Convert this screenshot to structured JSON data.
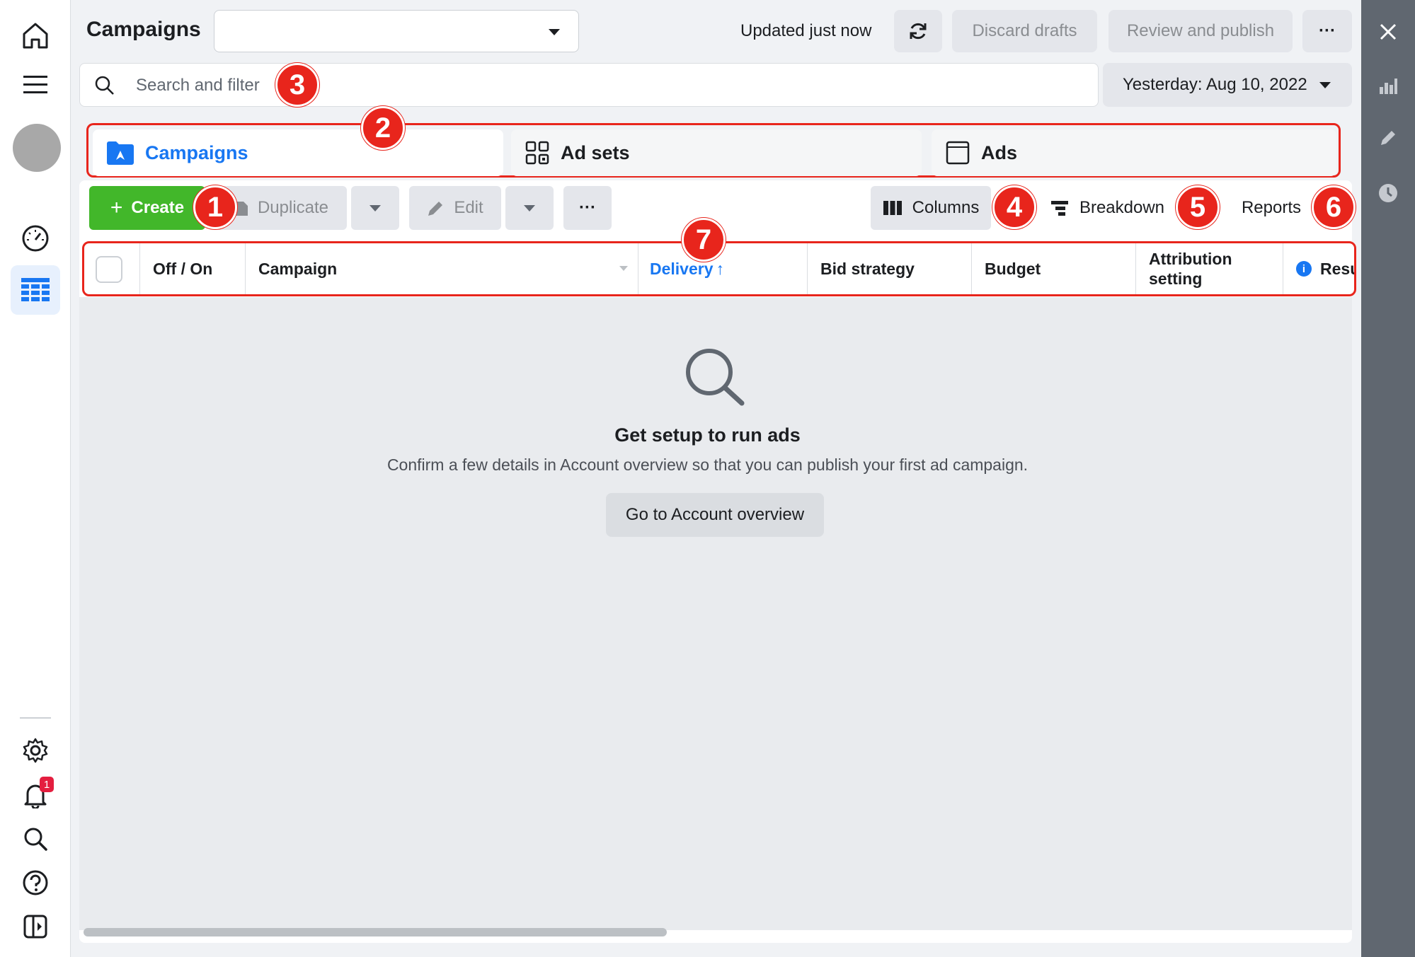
{
  "header": {
    "title": "Campaigns",
    "account_select_value": "",
    "updated_text": "Updated just now",
    "discard_label": "Discard drafts",
    "review_label": "Review and publish",
    "more_label": "···"
  },
  "search": {
    "placeholder": "Search and filter",
    "date_label": "Yesterday: Aug 10, 2022"
  },
  "tabs": [
    {
      "label": "Campaigns",
      "active": true
    },
    {
      "label": "Ad sets",
      "active": false
    },
    {
      "label": "Ads",
      "active": false
    }
  ],
  "toolbar": {
    "create_label": "Create",
    "duplicate_label": "Duplicate",
    "edit_label": "Edit",
    "more_label": "···",
    "columns_label": "Columns",
    "breakdown_label": "Breakdown",
    "reports_label": "Reports"
  },
  "table": {
    "columns": [
      "Off / On",
      "Campaign",
      "Delivery",
      "Bid strategy",
      "Budget",
      "Attribution setting",
      "Resu"
    ],
    "sorted_indicator": "↑"
  },
  "empty_state": {
    "title": "Get setup to run ads",
    "subtitle": "Confirm a few details in Account overview so that you can publish your first ad campaign.",
    "button_label": "Go to Account overview"
  },
  "sidebar": {
    "notification_count": "1"
  },
  "markers": [
    "1",
    "2",
    "3",
    "4",
    "5",
    "6",
    "7"
  ],
  "colors": {
    "accent_blue": "#1877f2",
    "create_green": "#42b72a",
    "annotation_red": "#e8251c",
    "right_rail": "#606770"
  }
}
